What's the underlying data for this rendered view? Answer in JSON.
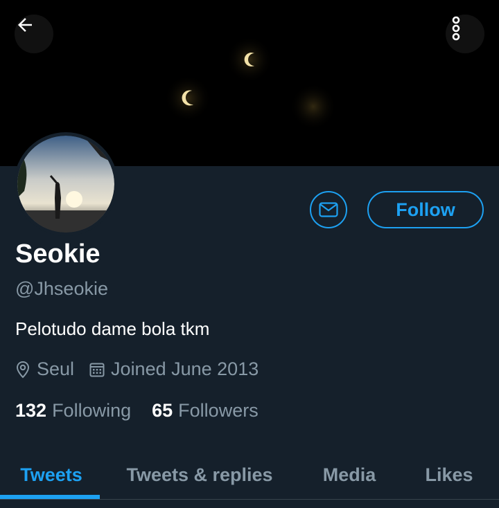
{
  "header": {
    "back_icon": "arrow-left-icon",
    "more_icon": "more-vertical-icon"
  },
  "profile": {
    "name": "Seokie",
    "handle": "@Jhseokie",
    "bio": "Pelotudo dame bola tkm",
    "location": "Seul",
    "location_icon": "location-pin-icon",
    "joined": "Joined June 2013",
    "joined_icon": "calendar-icon",
    "following_count": "132",
    "following_label": "Following",
    "followers_count": "65",
    "followers_label": "Followers"
  },
  "actions": {
    "message_icon": "envelope-icon",
    "follow_label": "Follow"
  },
  "tabs": [
    {
      "label": "Tweets",
      "active": true
    },
    {
      "label": "Tweets & replies",
      "active": false
    },
    {
      "label": "Media",
      "active": false
    },
    {
      "label": "Likes",
      "active": false
    }
  ],
  "colors": {
    "background": "#15202b",
    "accent": "#1da1f2",
    "secondary_text": "#8899a6"
  }
}
